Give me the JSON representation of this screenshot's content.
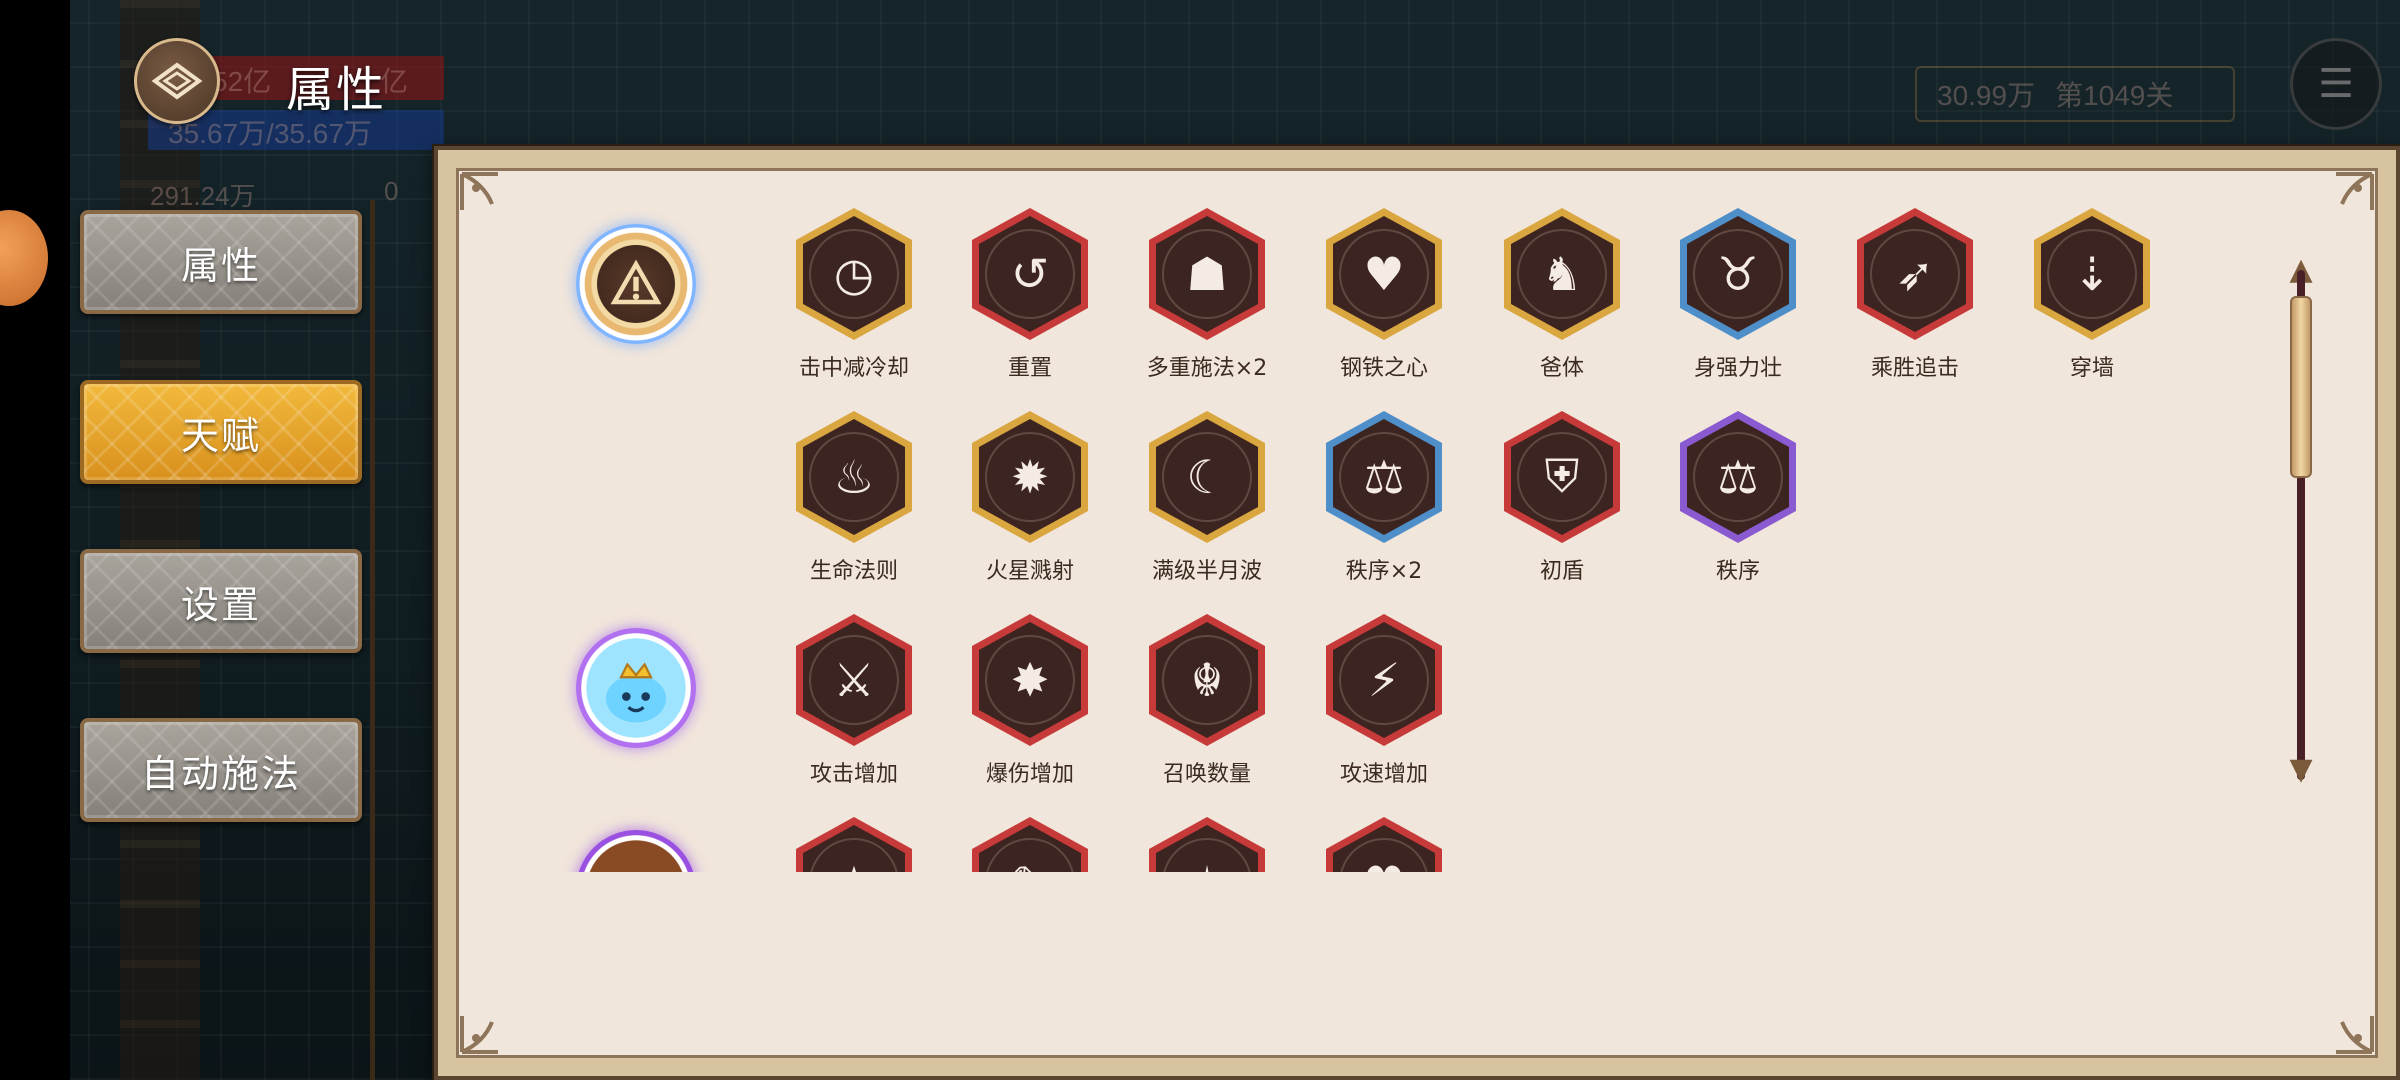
{
  "header": {
    "title": "属性",
    "back_icon": "diamond-back-icon"
  },
  "hud": {
    "hp_text": "52亿",
    "hp_text_right": "亿",
    "shield_text": "35.67万/35.67万",
    "attack_text": "291.24万",
    "defense_text": "0",
    "gold_text": "30.99万",
    "stage_text": "第1049关"
  },
  "menu": [
    {
      "label": "属性",
      "style": "grey"
    },
    {
      "label": "天赋",
      "style": "gold"
    },
    {
      "label": "设置",
      "style": "grey"
    },
    {
      "label": "自动施法",
      "style": "grey"
    }
  ],
  "colors": {
    "gold_frame": "#d9a640",
    "red_frame": "#c73a3a",
    "blue_frame": "#4f8fc9",
    "purple_frame": "#8a5ad0",
    "hex_fill": "#3c2420",
    "panel_bg": "#f1e6db"
  },
  "categories": [
    {
      "name": "triangle-emblem",
      "icon": "warning-triangle-icon"
    },
    {
      "name": "slime-king",
      "icon": "slime-king-icon"
    },
    {
      "name": "treasure",
      "icon": "treasure-chest-icon"
    }
  ],
  "talents": [
    {
      "label": "击中减冷却",
      "frame": "gold",
      "icon": "clock-cooldown-icon",
      "glyph": "◷"
    },
    {
      "label": "重置",
      "frame": "red",
      "icon": "reset-ring-icon",
      "glyph": "↺"
    },
    {
      "label": "多重施法×2",
      "frame": "red",
      "icon": "hooded-caster-icon",
      "glyph": "☗"
    },
    {
      "label": "钢铁之心",
      "frame": "gold",
      "icon": "mechanical-heart-icon",
      "glyph": "♥"
    },
    {
      "label": "爸体",
      "frame": "gold",
      "icon": "warrior-body-icon",
      "glyph": "♞"
    },
    {
      "label": "身强力壮",
      "frame": "blue",
      "icon": "bull-head-icon",
      "glyph": "♉"
    },
    {
      "label": "乘胜追击",
      "frame": "red",
      "icon": "running-figure-icon",
      "glyph": "➶"
    },
    {
      "label": "穿墙",
      "frame": "gold",
      "icon": "piercing-bullet-icon",
      "glyph": "⇣"
    },
    {
      "label": "生命法则",
      "frame": "gold",
      "icon": "life-flame-icon",
      "glyph": "♨"
    },
    {
      "label": "火星溅射",
      "frame": "gold",
      "icon": "spark-burst-icon",
      "glyph": "✹"
    },
    {
      "label": "满级半月波",
      "frame": "gold",
      "icon": "crescent-moon-icon",
      "glyph": "☾"
    },
    {
      "label": "秩序×2",
      "frame": "blue",
      "icon": "balance-scale-icon",
      "glyph": "⚖"
    },
    {
      "label": "初盾",
      "frame": "red",
      "icon": "helmet-shield-icon",
      "glyph": "⛨"
    },
    {
      "label": "秩序",
      "frame": "purple",
      "icon": "balance-scale-icon",
      "glyph": "⚖"
    },
    {
      "label": "攻击增加",
      "frame": "red",
      "icon": "sword-icon",
      "glyph": "⚔"
    },
    {
      "label": "爆伤增加",
      "frame": "red",
      "icon": "shatter-star-icon",
      "glyph": "✸"
    },
    {
      "label": "召唤数量",
      "frame": "red",
      "icon": "summon-beast-icon",
      "glyph": "☬"
    },
    {
      "label": "攻速增加",
      "frame": "red",
      "icon": "fast-sword-icon",
      "glyph": "⚡"
    },
    {
      "label": "",
      "frame": "red",
      "icon": "star-emblem-icon",
      "glyph": "★"
    },
    {
      "label": "",
      "frame": "red",
      "icon": "blade-icon",
      "glyph": "✎"
    },
    {
      "label": "",
      "frame": "red",
      "icon": "spiked-star-icon",
      "glyph": "✶"
    },
    {
      "label": "",
      "frame": "red",
      "icon": "heart-icon",
      "glyph": "♥"
    }
  ]
}
